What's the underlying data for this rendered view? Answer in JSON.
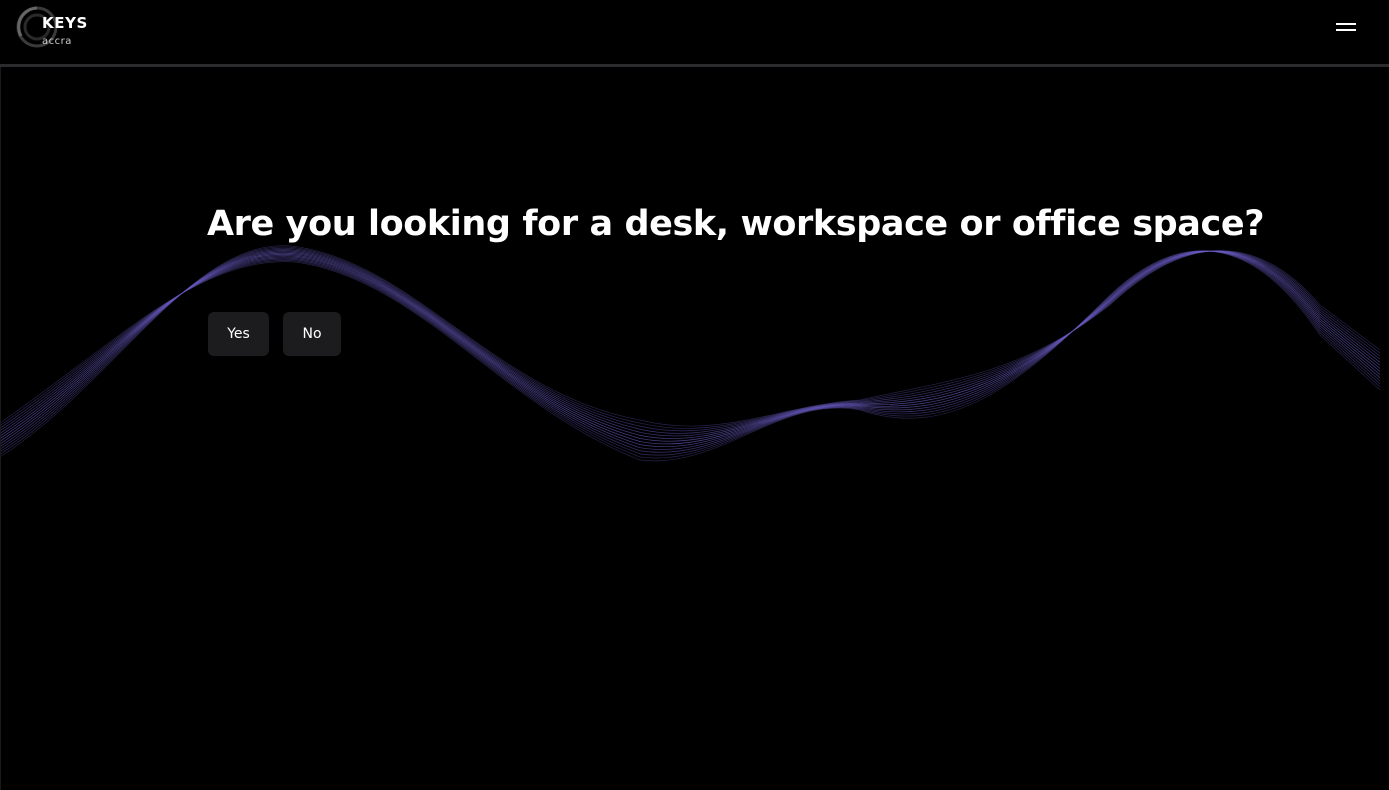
{
  "header": {
    "logo": {
      "name": "KEYS",
      "subtitle": "accra",
      "icon": "ring-logo-icon"
    },
    "menu_icon": "hamburger-menu-icon"
  },
  "main": {
    "question": "Are you looking for a desk, workspace or office space?",
    "options": [
      {
        "label": "Yes"
      },
      {
        "label": "No"
      }
    ]
  },
  "colors": {
    "background": "#000000",
    "button_bg": "#1c1c1e",
    "wave": "#6a5cc4",
    "header_border": "#2b2b2d"
  }
}
